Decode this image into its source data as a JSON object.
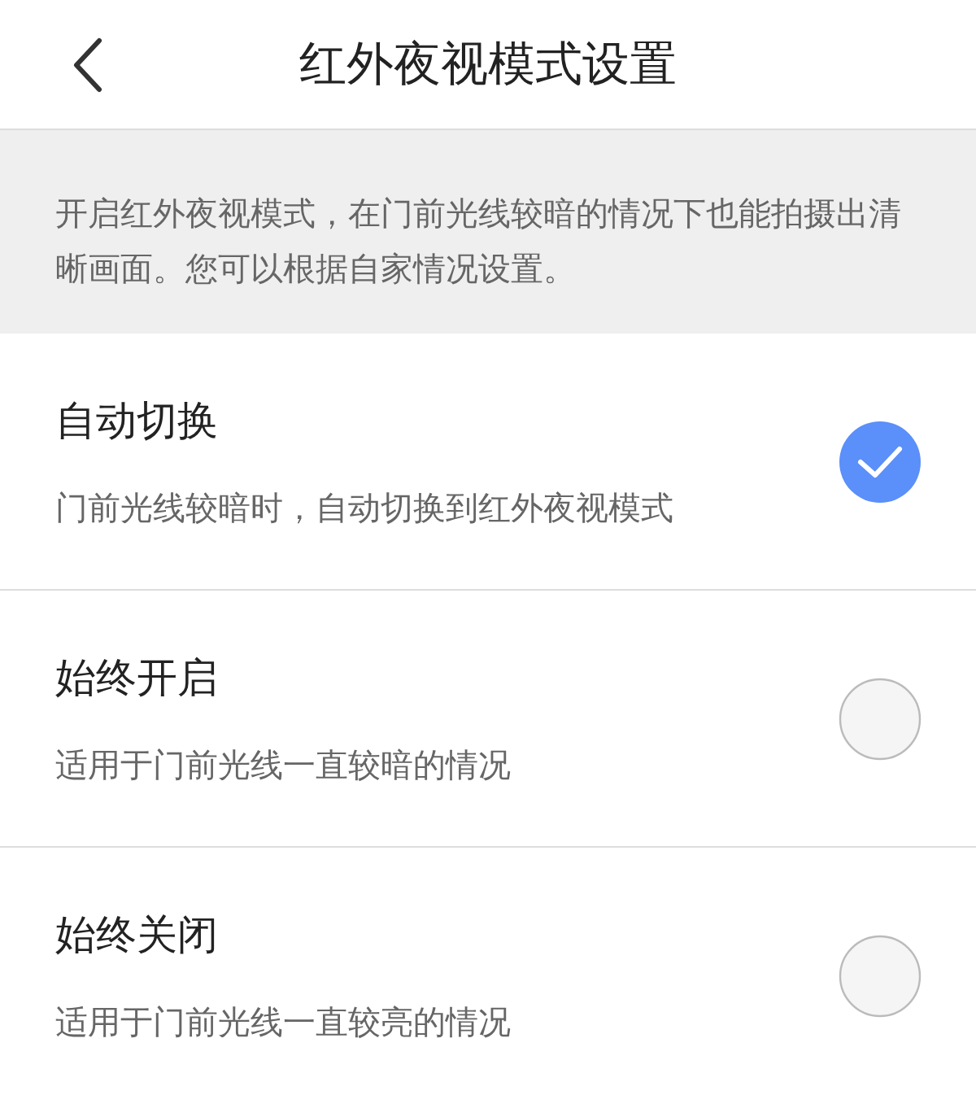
{
  "header": {
    "title": "红外夜视模式设置"
  },
  "notice": "开启红外夜视模式，在门前光线较暗的情况下也能拍摄出清晰画面。您可以根据自家情况设置。",
  "options": [
    {
      "title": "自动切换",
      "description": "门前光线较暗时，自动切换到红外夜视模式",
      "selected": true
    },
    {
      "title": "始终开启",
      "description": "适用于门前光线一直较暗的情况",
      "selected": false
    },
    {
      "title": "始终关闭",
      "description": "适用于门前光线一直较亮的情况",
      "selected": false
    }
  ]
}
